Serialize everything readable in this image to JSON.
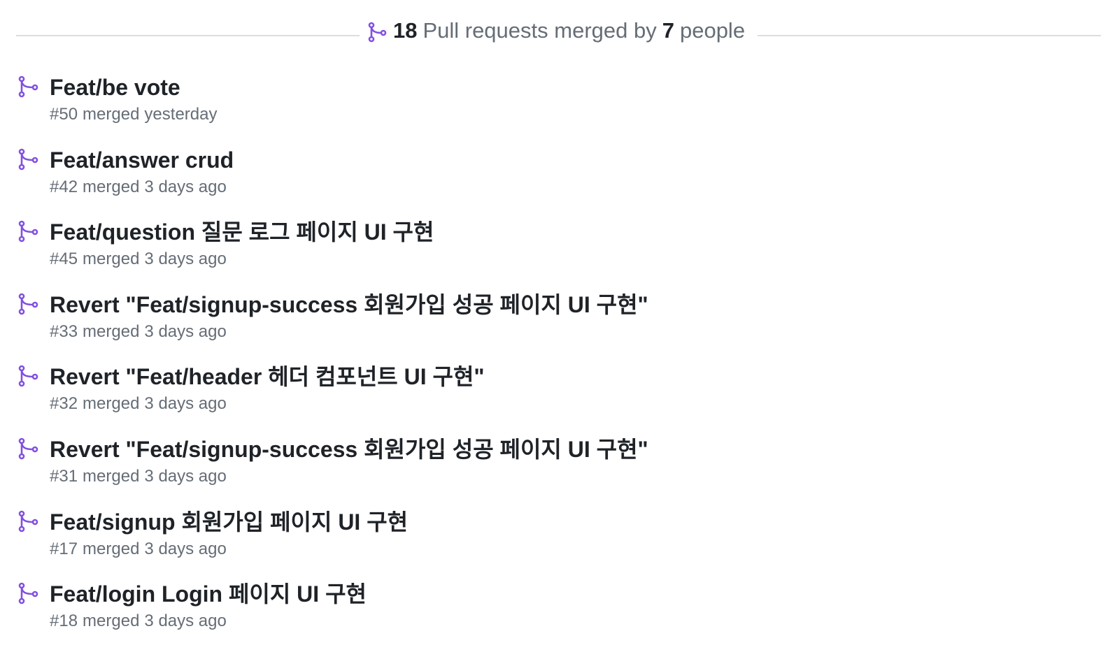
{
  "colors": {
    "merged_purple": "#8250df",
    "text_primary": "#1f2328",
    "text_muted": "#656d76",
    "divider": "#d8dee4"
  },
  "summary": {
    "icon": "git-merge-icon",
    "pr_count": "18",
    "pr_text": "Pull requests merged by",
    "people_count": "7",
    "people_text": "people"
  },
  "pull_requests": [
    {
      "title": "Feat/be vote",
      "number": "#50",
      "status": "merged",
      "time": "yesterday"
    },
    {
      "title": "Feat/answer crud",
      "number": "#42",
      "status": "merged",
      "time": "3 days ago"
    },
    {
      "title": "Feat/question 질문 로그 페이지 UI 구현",
      "number": "#45",
      "status": "merged",
      "time": "3 days ago"
    },
    {
      "title": "Revert \"Feat/signup-success 회원가입 성공 페이지 UI 구현\"",
      "number": "#33",
      "status": "merged",
      "time": "3 days ago"
    },
    {
      "title": "Revert \"Feat/header 헤더 컴포넌트 UI 구현\"",
      "number": "#32",
      "status": "merged",
      "time": "3 days ago"
    },
    {
      "title": "Revert \"Feat/signup-success 회원가입 성공 페이지 UI 구현\"",
      "number": "#31",
      "status": "merged",
      "time": "3 days ago"
    },
    {
      "title": "Feat/signup 회원가입 페이지 UI 구현",
      "number": "#17",
      "status": "merged",
      "time": "3 days ago"
    },
    {
      "title": "Feat/login Login 페이지 UI 구현",
      "number": "#18",
      "status": "merged",
      "time": "3 days ago"
    }
  ]
}
